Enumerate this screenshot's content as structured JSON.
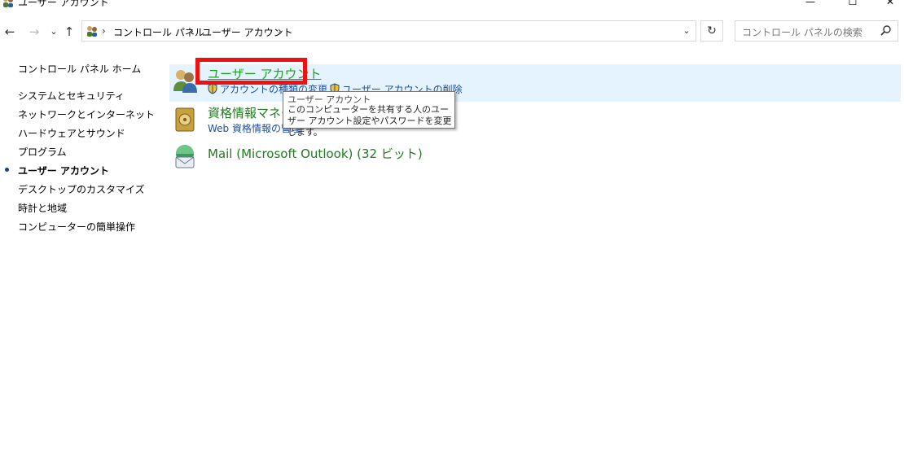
{
  "window": {
    "title": "ユーザー アカウント",
    "minimize_glyph": "—",
    "maximize_glyph": "☐",
    "close_glyph": "✕"
  },
  "nav": {
    "back_glyph": "←",
    "forward_glyph": "→",
    "recent_glyph": "⌄",
    "up_glyph": "↑"
  },
  "address": {
    "breadcrumbs": [
      "コントロール パネル",
      "ユーザー アカウント"
    ],
    "separator": "›",
    "dropdown_glyph": "⌄",
    "refresh_glyph": "↻"
  },
  "search": {
    "placeholder": "コントロール パネルの検索"
  },
  "sidebar": {
    "items": [
      {
        "label": "コントロール パネル ホーム"
      },
      {
        "label": "システムとセキュリティ"
      },
      {
        "label": "ネットワークとインターネット"
      },
      {
        "label": "ハードウェアとサウンド"
      },
      {
        "label": "プログラム"
      },
      {
        "label": "ユーザー アカウント",
        "active": true
      },
      {
        "label": "デスクトップのカスタマイズ"
      },
      {
        "label": "時計と地域"
      },
      {
        "label": "コンピューターの簡単操作"
      }
    ]
  },
  "categories": [
    {
      "title": "ユーザー アカウント",
      "links": [
        "アカウントの種類の変更",
        "ユーザー アカウントの削除"
      ]
    },
    {
      "title": "資格情報マネージャー",
      "links": [
        "Web 資格情報の管理"
      ]
    },
    {
      "title": "Mail (Microsoft Outlook) (32 ビット)",
      "links": []
    }
  ],
  "tooltip": {
    "title": "ユーザー アカウント",
    "body": "このコンピューターを共有する人のユーザー アカウント設定やパスワードを変更します。"
  },
  "colors": {
    "accent_red": "#ee1111",
    "link_blue": "#1a4fa8",
    "title_green": "#1e7c1e",
    "row_highlight": "#e5f3ff"
  }
}
